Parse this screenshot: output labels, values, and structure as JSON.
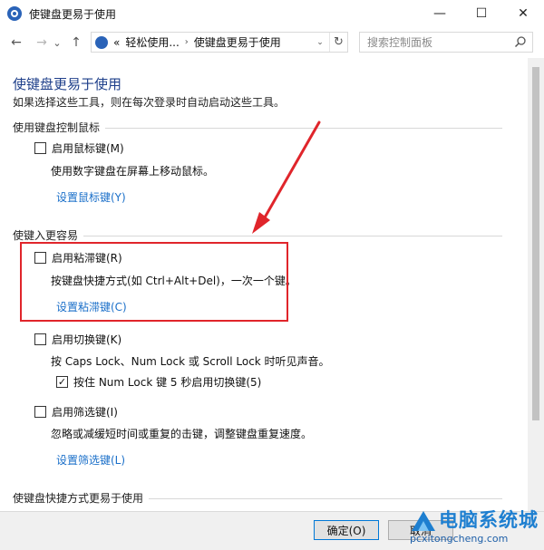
{
  "window": {
    "title": "使键盘更易于使用",
    "min": "—",
    "max": "☐",
    "close": "✕"
  },
  "nav": {
    "back": "←",
    "forward": "→",
    "history": "⌄",
    "up": "↑",
    "crumb_prefix": "«",
    "crumb_parent": "轻松使用...",
    "crumb_sep": "›",
    "crumb_current": "使键盘更易于使用",
    "dropdown": "⌄",
    "refresh": "↻",
    "search_placeholder": "搜索控制面板"
  },
  "page": {
    "title": "使键盘更易于使用",
    "description": "如果选择这些工具，则在每次登录时自动启动这些工具。"
  },
  "sections": {
    "mouse": {
      "heading": "使用键盘控制鼠标",
      "option_label": "启用鼠标键(M)",
      "option_checked": false,
      "description": "使用数字键盘在屏幕上移动鼠标。",
      "link": "设置鼠标键(Y)"
    },
    "typing": {
      "heading": "使键入更容易",
      "sticky_label": "启用粘滞键(R)",
      "sticky_checked": false,
      "sticky_description": "按键盘快捷方式(如 Ctrl+Alt+Del)，一次一个键。",
      "sticky_link": "设置粘滞键(C)",
      "toggle_label": "启用切换键(K)",
      "toggle_checked": false,
      "toggle_description": "按 Caps Lock、Num Lock 或 Scroll Lock 时听见声音。",
      "toggle_sub_label": "按住 Num Lock 键 5 秒启用切换键(5)",
      "toggle_sub_checked": true,
      "filter_label": "启用筛选键(I)",
      "filter_checked": false,
      "filter_description": "忽略或减缓短时间或重复的击键，调整键盘重复速度。",
      "filter_link": "设置筛选键(L)"
    },
    "shortcuts": {
      "heading": "使键盘快捷方式更易于使用"
    }
  },
  "buttons": {
    "ok": "确定(O)",
    "cancel": "取消"
  },
  "checkmark": "✓",
  "watermark": {
    "title": "电脑系统城",
    "subtitle": "pcxitongcheng.com"
  },
  "colors": {
    "highlight": "#e0252b",
    "link": "#1a6fc9",
    "title": "#1e3f8a"
  }
}
